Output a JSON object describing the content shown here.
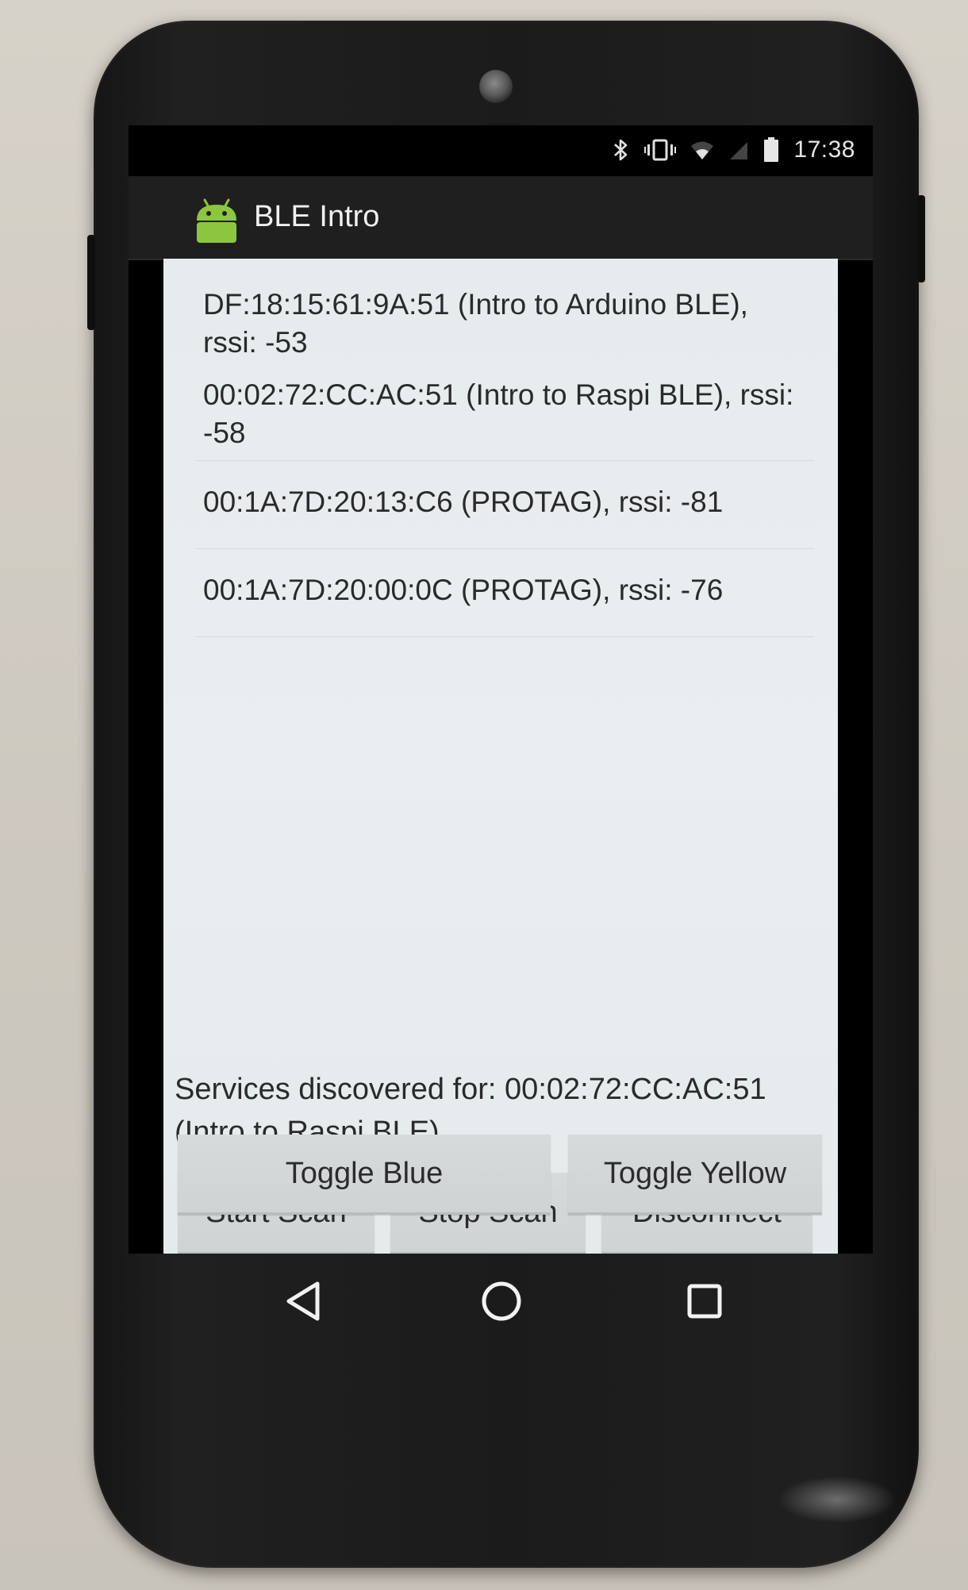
{
  "status_bar": {
    "time": "17:38",
    "icons": [
      "bluetooth-icon",
      "vibrate-icon",
      "wifi-icon",
      "signal-icon",
      "battery-icon"
    ]
  },
  "action_bar": {
    "title": "BLE Intro",
    "icon": "android-icon"
  },
  "devices": [
    {
      "text": "DF:18:15:61:9A:51 (Intro to Arduino BLE), rssi: -53"
    },
    {
      "text": "00:02:72:CC:AC:51 (Intro to Raspi BLE), rssi: -58"
    },
    {
      "text": "00:1A:7D:20:13:C6 (PROTAG), rssi: -81"
    },
    {
      "text": "00:1A:7D:20:00:0C (PROTAG), rssi: -76"
    }
  ],
  "services_text": "Services discovered for: 00:02:72:CC:AC:51 (Intro to Raspi BLE)",
  "buttons": {
    "start_scan": "Start Scan",
    "stop_scan": "Stop Scan",
    "disconnect": "Disconnect",
    "toggle_blue": "Toggle Blue",
    "toggle_yellow": "Toggle Yellow"
  },
  "nav": {
    "back": "back-icon",
    "home": "home-icon",
    "recents": "recents-icon"
  },
  "colors": {
    "android_green": "#8cc63f",
    "content_bg": "#e8edef",
    "button_bg": "#d3d7d8",
    "action_bar": "#1f1f1f"
  }
}
